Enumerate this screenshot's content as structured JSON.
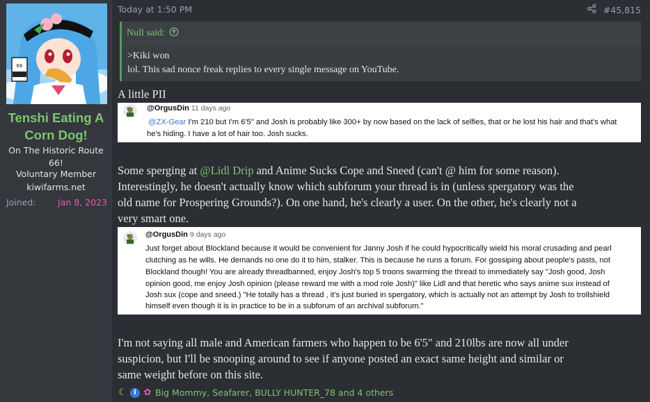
{
  "user": {
    "avatar_icon": "tenshi-avatar-image",
    "name": "Tenshi Eating A Corn Dog!",
    "title": "On The Historic Route 66!",
    "role": "Voluntary Member",
    "site": "kiwifarms.net",
    "joined_label": "Joined:",
    "joined_value": "Jan 8, 2023"
  },
  "post": {
    "timestamp": "Today at 1:50 PM",
    "share_icon": "share-icon",
    "number": "#45,815",
    "quote": {
      "author": "Null said:",
      "line1": ">Kiki won",
      "line2": "lol. This sad nonce freak replies to every single message on YouTube."
    },
    "para1": "A little PII",
    "shot1": {
      "handle": "@OrgusDin",
      "ago": "11 days ago",
      "mention": "@ZX-Gear",
      "text_a": " I'm 210 but I'm 6'5\" and Josh is probably like 300+ by now based on the lack of selfies, that or he lost his hair and that's what",
      "text_b": "he's hiding. I have a lot of hair too. Josh sucks."
    },
    "para2_a": "Some sperging at ",
    "para2_mention": "@Lidl Drip",
    "para2_b": " and Anime Sucks Cope and Sneed (can't @ him for some reason).",
    "para2_c": "Interestingly, he doesn't actually know which subforum your thread is in (unless spergatory was the",
    "para2_d": "old name for Prospering Grounds?). On one hand, he's clearly a user. On the other, he's clearly not a",
    "para2_e": "very smart one.",
    "shot2": {
      "handle": "@OrgusDin",
      "ago": "9 days ago",
      "l1": "Just forget about Blockland because it would be convenient for Janny Josh if he could hypocritically wield his moral crusading and pearl",
      "l2": "clutching as he wills. He demands no one do it to him, stalker. This is because he runs a forum. For gossiping about people's pasts, not",
      "l3": "Blockland though! You are already threadbanned, enjoy Josh's top 5 troons swarming the thread to immediately say \"Josh good, Josh",
      "l4": "opinion good, me enjoy Josh opinion (please reward me with a mod role Josh)\" like Lidl and that heretic who says anime sux instead of",
      "l5": "Josh sux (cope and sneed.) \"He totally has a thread , it's just buried in spergatory, which is actually not an attempt by Josh to trollshield",
      "l6": "himself even though it is in practice to be in a subforum of an archival subforum.\""
    },
    "para3_a": "I'm not saying all male and American farmers who happen to be 6'5\" and 210lbs are now all under",
    "para3_b": "suspicion, but I'll be snooping around to see if anyone posted an exact same height and similar or",
    "para3_c": "same weight before on this site.",
    "reactions": {
      "icons": [
        "moon-icon",
        "info-icon",
        "flower-icon"
      ],
      "text": "Big Mommy, Seafarer, BULLY HUNTER_78 and 4 others"
    }
  },
  "colors": {
    "accent_green": "#7fc472",
    "joined_pink": "#e45db3",
    "background": "#2b2e33",
    "sidebar": "#34373c"
  }
}
